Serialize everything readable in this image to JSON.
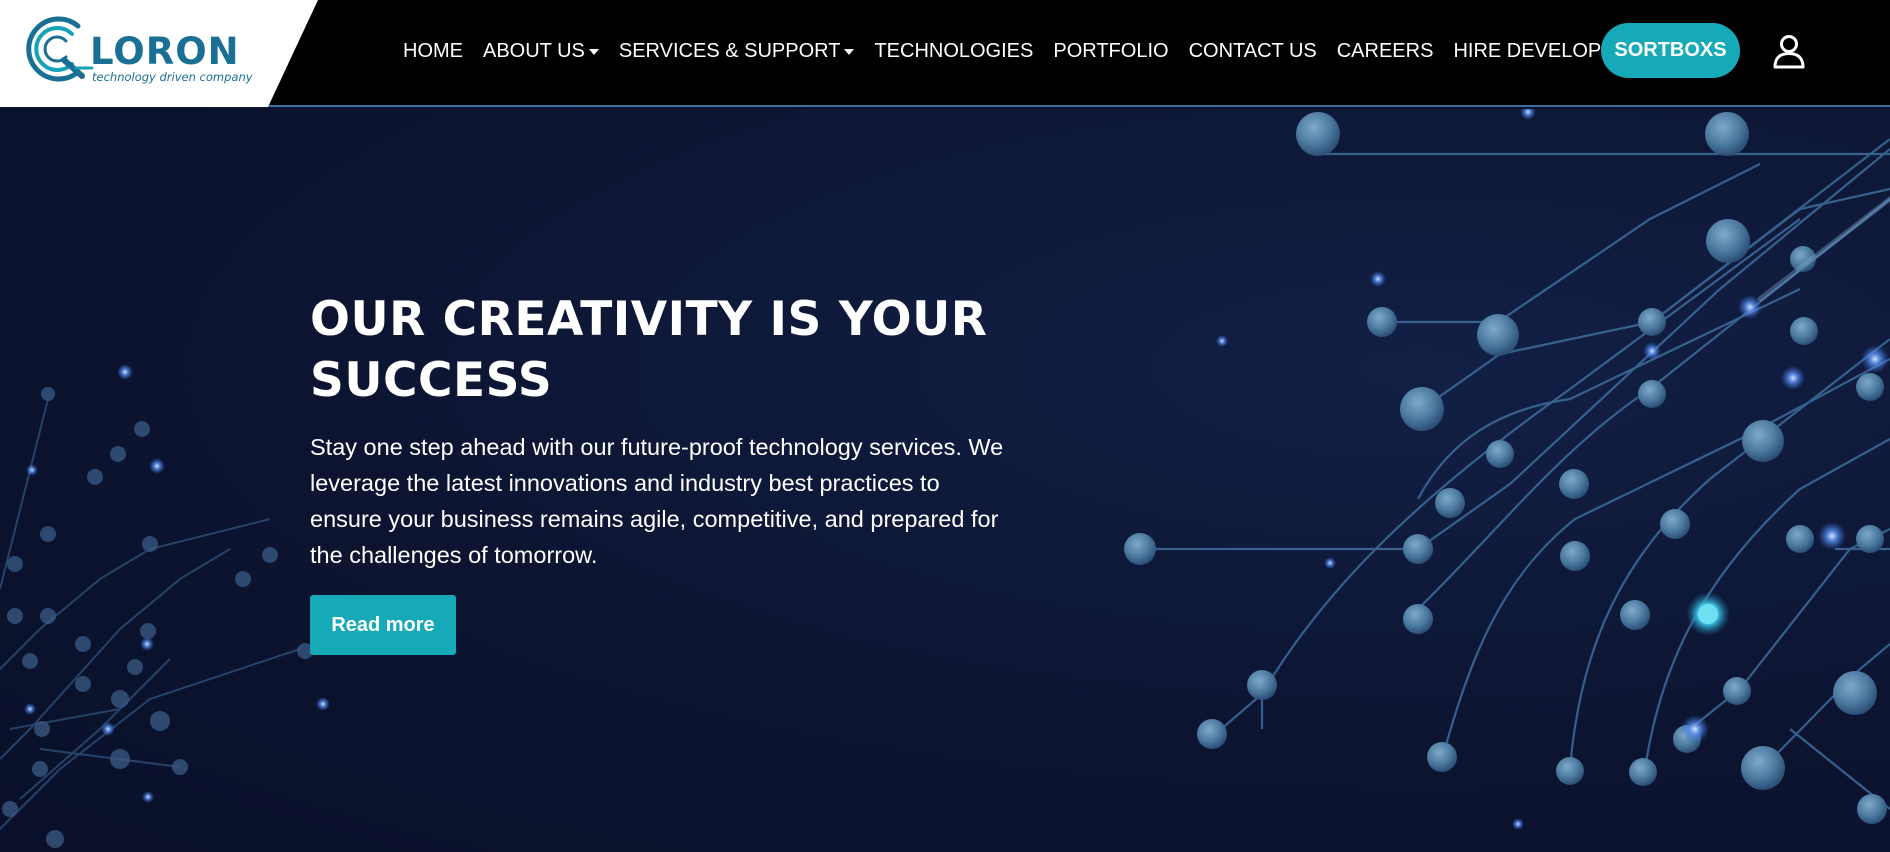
{
  "brand": {
    "name": "LORON",
    "tagline": "technology driven company",
    "accent_color": "#16a9b8",
    "logo_color": "#1a6f94"
  },
  "nav": {
    "items": [
      {
        "label": "HOME",
        "has_dropdown": false
      },
      {
        "label": "ABOUT US",
        "has_dropdown": true
      },
      {
        "label": "SERVICES & SUPPORT",
        "has_dropdown": true
      },
      {
        "label": "TECHNOLOGIES",
        "has_dropdown": false
      },
      {
        "label": "PORTFOLIO",
        "has_dropdown": false
      },
      {
        "label": "CONTACT US",
        "has_dropdown": false
      },
      {
        "label": "CAREERS",
        "has_dropdown": false
      },
      {
        "label": "HIRE DEVELOPERS",
        "has_dropdown": false
      }
    ],
    "cta_label": "SORTBOXS",
    "user_icon": "user-icon"
  },
  "hero": {
    "title": "OUR CREATIVITY IS YOUR SUCCESS",
    "text": "Stay one step ahead with our future-proof technology services. We leverage the latest innovations and industry best practices to ensure your business remains agile, competitive, and prepared for the challenges of tomorrow.",
    "button_label": "Read more"
  }
}
